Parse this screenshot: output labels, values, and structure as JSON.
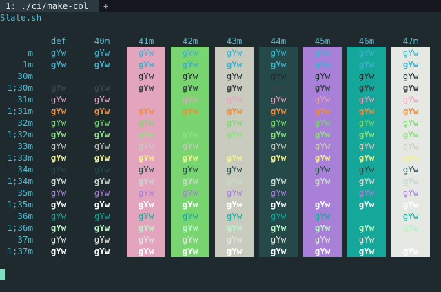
{
  "tab": {
    "label": "1: ./ci/make-col",
    "new_tab": "+"
  },
  "title": "Slate.sh",
  "sample": "gYw",
  "columns": [
    {
      "label": "def",
      "bg": null
    },
    {
      "label": "40m",
      "bg": null
    },
    {
      "label": "41m",
      "bg": "#e3a5bd"
    },
    {
      "label": "42m",
      "bg": "#79d56f"
    },
    {
      "label": "43m",
      "bg": "#c9cbbf"
    },
    {
      "label": "44m",
      "bg": "#254949"
    },
    {
      "label": "45m",
      "bg": "#a980d8"
    },
    {
      "label": "46m",
      "bg": "#15a89a"
    },
    {
      "label": "47m",
      "bg": "#e6e8e4"
    }
  ],
  "rows": [
    {
      "label": "m",
      "fg": "#3fb1cc"
    },
    {
      "label": "1m",
      "fg": "#3fb1cc",
      "bold": true
    },
    {
      "label": "30m",
      "fg": "#1e2a2e"
    },
    {
      "label": "1;30m",
      "fg": "#3a4448",
      "bold": true
    },
    {
      "label": "31m",
      "fg": "#e3a5bd"
    },
    {
      "label": "1;31m",
      "fg": "#f28c3c",
      "bold": true
    },
    {
      "label": "32m",
      "fg": "#79d56f"
    },
    {
      "label": "1;32m",
      "fg": "#8ee080",
      "bold": true
    },
    {
      "label": "33m",
      "fg": "#c9cbbf"
    },
    {
      "label": "1;33m",
      "fg": "#f2f08c",
      "bold": true
    },
    {
      "label": "34m",
      "fg": "#254949"
    },
    {
      "label": "1;34m",
      "fg": "#c9d6cc",
      "bold": true
    },
    {
      "label": "35m",
      "fg": "#a980d8"
    },
    {
      "label": "1;35m",
      "fg": "#ffffff",
      "bold": true
    },
    {
      "label": "36m",
      "fg": "#15a89a"
    },
    {
      "label": "1;36m",
      "fg": "#b8f4c4",
      "bold": true
    },
    {
      "label": "37m",
      "fg": "#e6e8e4"
    },
    {
      "label": "1;37m",
      "fg": "#ffffff",
      "bold": true
    }
  ]
}
